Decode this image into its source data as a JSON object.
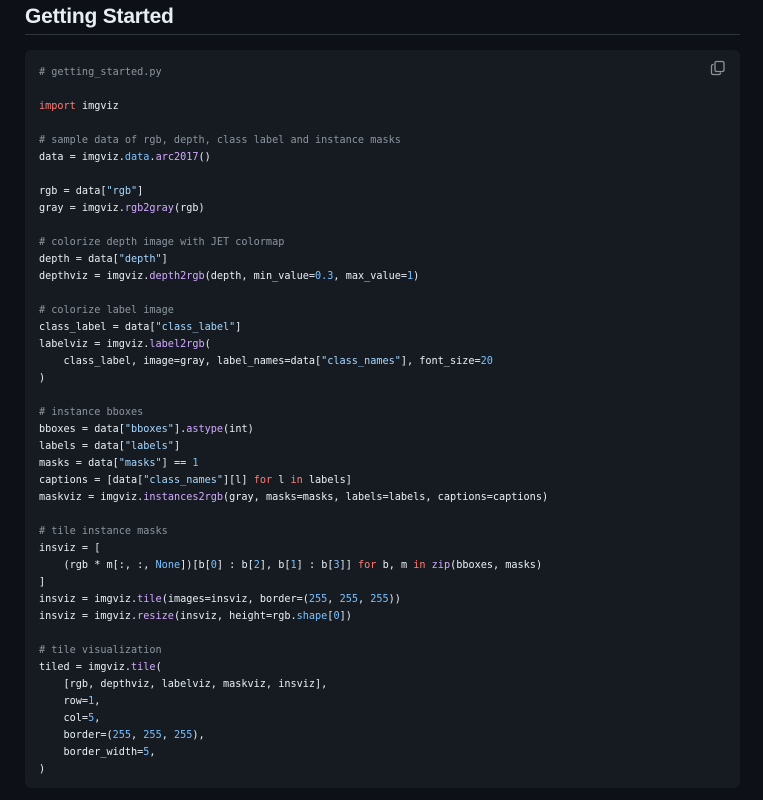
{
  "heading": "Getting Started",
  "copy_icon": "copy-icon",
  "colors": {
    "background": "#0d1117",
    "code_background": "#161b22",
    "comment": "#8b949e",
    "keyword": "#ff7b72",
    "function": "#d2a8ff",
    "attribute": "#79c0ff",
    "string": "#a5d6ff",
    "number": "#79c0ff"
  },
  "code_lines": [
    [
      [
        "c",
        "# getting_started.py"
      ]
    ],
    [],
    [
      [
        "k",
        "import"
      ],
      [
        "",
        " imgviz"
      ]
    ],
    [],
    [
      [
        "c",
        "# sample data of rgb, depth, class label and instance masks"
      ]
    ],
    [
      [
        "",
        "data = imgviz."
      ],
      [
        "a",
        "data"
      ],
      [
        "",
        "."
      ],
      [
        "f",
        "arc2017"
      ],
      [
        "",
        "()"
      ]
    ],
    [],
    [
      [
        "",
        "rgb = data["
      ],
      [
        "s",
        "\"rgb\""
      ],
      [
        "",
        "]"
      ]
    ],
    [
      [
        "",
        "gray = imgviz."
      ],
      [
        "f",
        "rgb2gray"
      ],
      [
        "",
        "(rgb)"
      ]
    ],
    [],
    [
      [
        "c",
        "# colorize depth image with JET colormap"
      ]
    ],
    [
      [
        "",
        "depth = data["
      ],
      [
        "s",
        "\"depth\""
      ],
      [
        "",
        "]"
      ]
    ],
    [
      [
        "",
        "depthviz = imgviz."
      ],
      [
        "f",
        "depth2rgb"
      ],
      [
        "",
        "(depth, min_value="
      ],
      [
        "n",
        "0.3"
      ],
      [
        "",
        ", max_value="
      ],
      [
        "n",
        "1"
      ],
      [
        "",
        ")"
      ]
    ],
    [],
    [
      [
        "c",
        "# colorize label image"
      ]
    ],
    [
      [
        "",
        "class_label = data["
      ],
      [
        "s",
        "\"class_label\""
      ],
      [
        "",
        "]"
      ]
    ],
    [
      [
        "",
        "labelviz = imgviz."
      ],
      [
        "f",
        "label2rgb"
      ],
      [
        "",
        "("
      ]
    ],
    [
      [
        "",
        "    class_label, image=gray, label_names=data["
      ],
      [
        "s",
        "\"class_names\""
      ],
      [
        "",
        "], font_size="
      ],
      [
        "n",
        "20"
      ]
    ],
    [
      [
        "",
        ")"
      ]
    ],
    [],
    [
      [
        "c",
        "# instance bboxes"
      ]
    ],
    [
      [
        "",
        "bboxes = data["
      ],
      [
        "s",
        "\"bboxes\""
      ],
      [
        "",
        "]."
      ],
      [
        "f",
        "astype"
      ],
      [
        "",
        "(int)"
      ]
    ],
    [
      [
        "",
        "labels = data["
      ],
      [
        "s",
        "\"labels\""
      ],
      [
        "",
        "]"
      ]
    ],
    [
      [
        "",
        "masks = data["
      ],
      [
        "s",
        "\"masks\""
      ],
      [
        "",
        "] == "
      ],
      [
        "n",
        "1"
      ]
    ],
    [
      [
        "",
        "captions = [data["
      ],
      [
        "s",
        "\"class_names\""
      ],
      [
        "",
        "][l] "
      ],
      [
        "k",
        "for"
      ],
      [
        "",
        " l "
      ],
      [
        "k",
        "in"
      ],
      [
        "",
        " labels]"
      ]
    ],
    [
      [
        "",
        "maskviz = imgviz."
      ],
      [
        "f",
        "instances2rgb"
      ],
      [
        "",
        "(gray, masks=masks, labels=labels, captions=captions)"
      ]
    ],
    [],
    [
      [
        "c",
        "# tile instance masks"
      ]
    ],
    [
      [
        "",
        "insviz = ["
      ]
    ],
    [
      [
        "",
        "    (rgb * m[:, :, "
      ],
      [
        "a",
        "None"
      ],
      [
        "",
        "])[b["
      ],
      [
        "n",
        "0"
      ],
      [
        "",
        "] : b["
      ],
      [
        "n",
        "2"
      ],
      [
        "",
        "], b["
      ],
      [
        "n",
        "1"
      ],
      [
        "",
        "] : b["
      ],
      [
        "n",
        "3"
      ],
      [
        "",
        "]] "
      ],
      [
        "k",
        "for"
      ],
      [
        "",
        " b, m "
      ],
      [
        "k",
        "in"
      ],
      [
        "",
        " "
      ],
      [
        "f",
        "zip"
      ],
      [
        "",
        "(bboxes, masks)"
      ]
    ],
    [
      [
        "",
        "]"
      ]
    ],
    [
      [
        "",
        "insviz = imgviz."
      ],
      [
        "f",
        "tile"
      ],
      [
        "",
        "(images=insviz, border=("
      ],
      [
        "n",
        "255"
      ],
      [
        "",
        ", "
      ],
      [
        "n",
        "255"
      ],
      [
        "",
        ", "
      ],
      [
        "n",
        "255"
      ],
      [
        "",
        "))"
      ]
    ],
    [
      [
        "",
        "insviz = imgviz."
      ],
      [
        "f",
        "resize"
      ],
      [
        "",
        "(insviz, height=rgb."
      ],
      [
        "a",
        "shape"
      ],
      [
        "",
        "["
      ],
      [
        "n",
        "0"
      ],
      [
        "",
        "])"
      ]
    ],
    [],
    [
      [
        "c",
        "# tile visualization"
      ]
    ],
    [
      [
        "",
        "tiled = imgviz."
      ],
      [
        "f",
        "tile"
      ],
      [
        "",
        "("
      ]
    ],
    [
      [
        "",
        "    [rgb, depthviz, labelviz, maskviz, insviz],"
      ]
    ],
    [
      [
        "",
        "    row="
      ],
      [
        "n",
        "1"
      ],
      [
        "",
        ","
      ]
    ],
    [
      [
        "",
        "    col="
      ],
      [
        "n",
        "5"
      ],
      [
        "",
        ","
      ]
    ],
    [
      [
        "",
        "    border=("
      ],
      [
        "n",
        "255"
      ],
      [
        "",
        ", "
      ],
      [
        "n",
        "255"
      ],
      [
        "",
        ", "
      ],
      [
        "n",
        "255"
      ],
      [
        "",
        "),"
      ]
    ],
    [
      [
        "",
        "    border_width="
      ],
      [
        "n",
        "5"
      ],
      [
        "",
        ","
      ]
    ],
    [
      [
        "",
        ")"
      ]
    ]
  ]
}
